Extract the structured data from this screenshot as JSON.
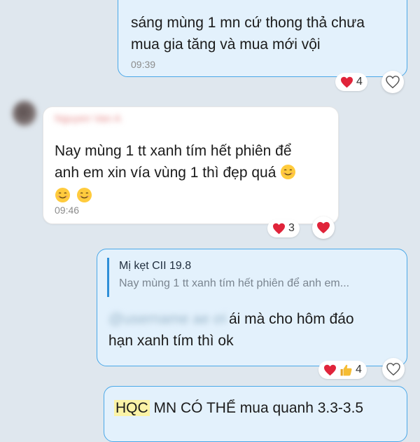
{
  "messages": {
    "m1": {
      "line1": "sáng mùng 1 mn cứ thong thả chưa",
      "line2": "mua gia tăng và mua mới vội",
      "time": "09:39",
      "reaction_count": "4"
    },
    "m2": {
      "sender_name": "Nguyen Van A",
      "line1": "Nay mùng 1 tt xanh tím hết phiên để",
      "line2": "anh em xin vía vùng 1 thì đẹp quá",
      "time": "09:46",
      "reaction_count": "3"
    },
    "m3": {
      "quote_author": "Mị kẹt CII 19.8",
      "quote_text": "Nay mùng 1 tt xanh tím hết phiên để anh em...",
      "mention": "@username ae ơi",
      "line1_rest": "ái mà cho hôm đáo",
      "line2": "hạn xanh tím thì ok",
      "reaction_count": "4"
    },
    "m4": {
      "highlight": "HQC",
      "rest": " MN CÓ THỂ mua quanh 3.3-3.5"
    }
  },
  "colors": {
    "outgoing_bubble": "#e3f1fc",
    "outgoing_border": "#4aa8e8",
    "background": "#dfe7ee",
    "heart": "#e0243a",
    "quote_bar": "#2f8fd8",
    "highlight": "#fbf3a6"
  },
  "icons": {
    "like": "heart-outline-icon",
    "liked": "heart-filled-icon",
    "reaction_heart": "heart-icon",
    "reaction_thumb": "thumbs-up-icon",
    "emoji": "smiling-face-icon"
  }
}
